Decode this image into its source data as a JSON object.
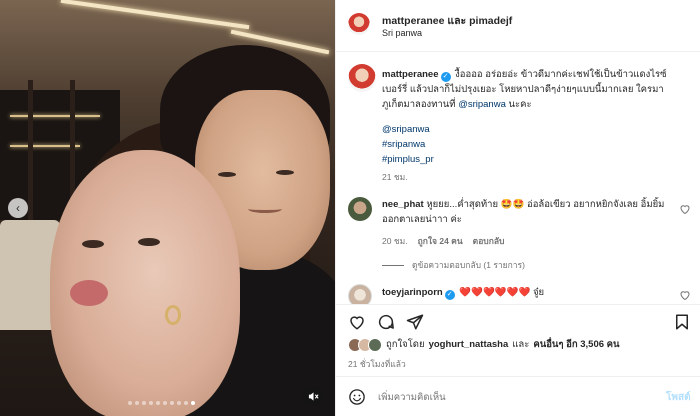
{
  "header": {
    "title": "mattperanee และ pimadejf",
    "location": "Sri panwa"
  },
  "caption": {
    "username": "mattperanee",
    "text": "งื้ออออ อร่อยอ่ะ ข้าวดีมากค่ะเชฟใช้เป็นข้าวแดงไรซ์เบอร์รี่ แล้วปลาก็ไม่ปรุงเยอะ โหยหาปลาดีๆง่ายๆแบบนี้มากเลย ใครมาภูเก็ตมาลองทานที่",
    "mention": "@sripanwa",
    "suffix": "นะคะ",
    "tags": [
      "@sripanwa",
      "#sripanwa",
      "#pimplus_pr"
    ],
    "time": "21 ชม."
  },
  "comments": [
    {
      "username": "nee_phat",
      "text": "หูยยย...ค่ำสุดท้าย 🤩🤩 อ่อล้อเขียว อยากหยิกจังเลย อิ้มยิ้มออกตาเลยน่าาา ค่ะ",
      "time": "20 ชม.",
      "likes": "ถูกใจ 24 คน",
      "reply": "ตอบกลับ",
      "view_replies": "ดูข้อความตอบกลับ (1 รายการ)"
    },
    {
      "username": "toeyjarinporn",
      "text": "❤️❤️❤️❤️❤️❤️ จู๋ย"
    }
  ],
  "likes": {
    "prefix": "ถูกใจโดย",
    "user": "yoghurt_nattasha",
    "conj": "และ",
    "others": "คนอื่นๆ อีก 3,506 คน"
  },
  "posted": "21 ชั่วโมงที่แล้ว",
  "composer": {
    "placeholder": "เพิ่มความคิดเห็น",
    "post_label": "โพสต์"
  },
  "colors": {
    "link": "#00376b",
    "muted": "#737373",
    "verified": "#1d9bf0",
    "post_disabled": "#b2dffc",
    "heart": "#ed4956"
  },
  "carousel": {
    "dot_count": 10,
    "active_dot": 10
  }
}
